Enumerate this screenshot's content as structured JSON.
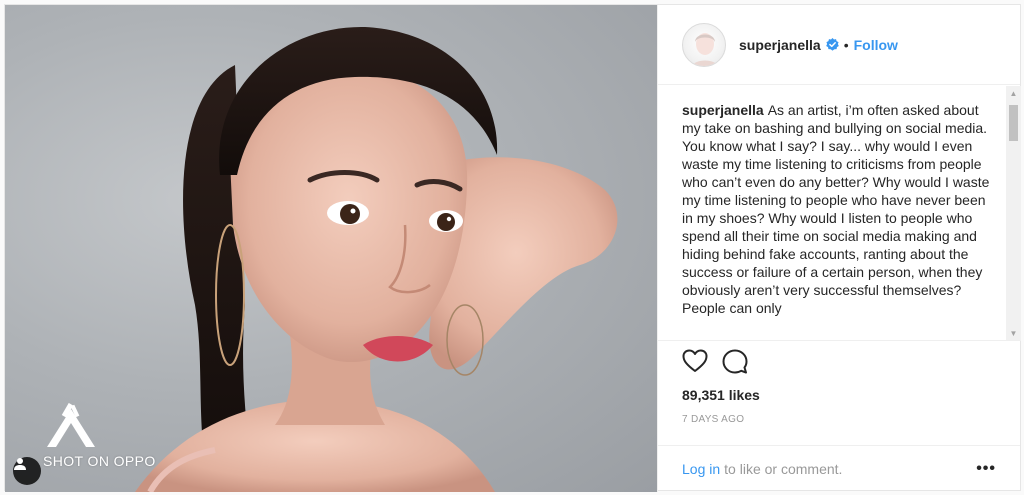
{
  "post": {
    "username": "superjanella",
    "follow_label": "Follow",
    "separator": "•",
    "caption": "As an artist, i’m often asked about my take on bashing and bullying on social media. You know what I say? I say... why would I even waste my time listening to criticisms from people who can’t even do any better? Why would I waste my time listening to people who have never been in my shoes? Why would I listen to people who spend all their time on social media making and hiding behind fake accounts, ranting about the success or failure of a certain person, when they obviously aren’t very successful themselves? People can only",
    "likes": "89,351 likes",
    "time_ago": "7 DAYS AGO",
    "login_link": "Log in",
    "login_rest": "to like or comment.",
    "more_label": "•••"
  },
  "photo": {
    "watermark_text": "SHOT ON OPPO"
  },
  "colors": {
    "link_blue": "#3897f0",
    "verified_blue": "#3897f0",
    "muted": "#999999"
  },
  "icons": [
    "heart-icon",
    "comment-icon",
    "verified-badge-icon",
    "user-tag-icon",
    "oppo-logo-icon"
  ]
}
